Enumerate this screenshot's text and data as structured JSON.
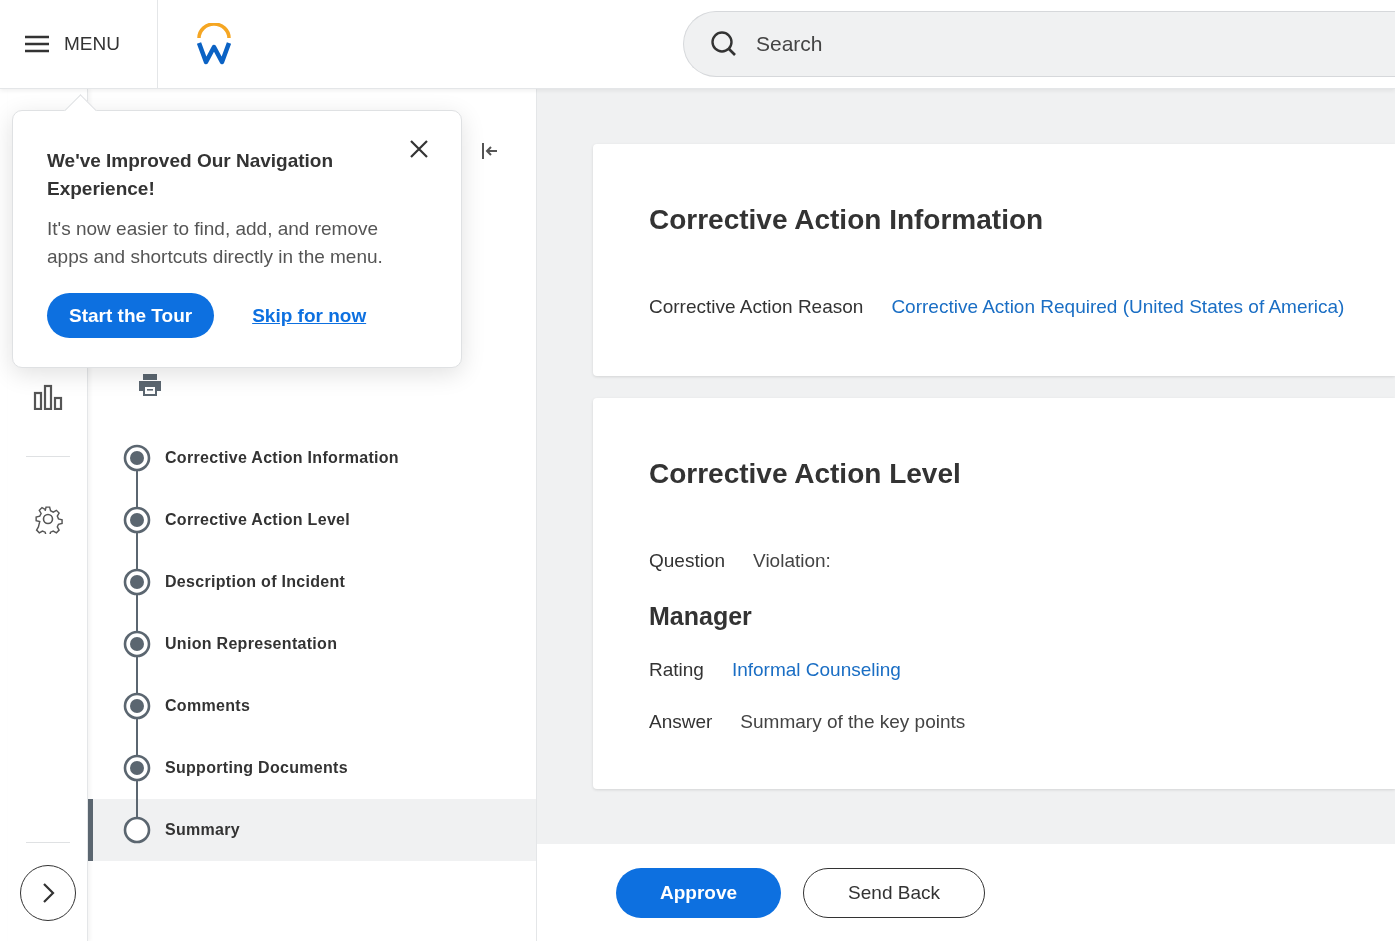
{
  "header": {
    "menu_label": "MENU",
    "search": {
      "placeholder": "Search"
    }
  },
  "popover": {
    "title": "We've Improved Our Navigation Experience!",
    "body": "It's now easier to find, add, and remove apps and shortcuts directly in the menu.",
    "primary_button": "Start the Tour",
    "link": "Skip for now"
  },
  "steps": [
    {
      "label": "Corrective Action Information",
      "completed": true,
      "selected": false
    },
    {
      "label": "Corrective Action Level",
      "completed": true,
      "selected": false
    },
    {
      "label": "Description of Incident",
      "completed": true,
      "selected": false
    },
    {
      "label": "Union Representation",
      "completed": true,
      "selected": false
    },
    {
      "label": "Comments",
      "completed": true,
      "selected": false
    },
    {
      "label": "Supporting Documents",
      "completed": true,
      "selected": false
    },
    {
      "label": "Summary",
      "completed": false,
      "selected": true
    }
  ],
  "cards": [
    {
      "title": "Corrective Action Information",
      "items": [
        {
          "kind": "field",
          "label": "Corrective Action Reason",
          "value": "Corrective Action Required (United States of America)",
          "link": true
        }
      ]
    },
    {
      "title": "Corrective Action Level",
      "items": [
        {
          "kind": "field",
          "label": "Question",
          "value": "Violation:",
          "link": false
        },
        {
          "kind": "heading",
          "text": "Manager"
        },
        {
          "kind": "field",
          "label": "Rating",
          "value": "Informal Counseling",
          "link": true
        },
        {
          "kind": "field",
          "label": "Answer",
          "value": "Summary of the key points",
          "link": false
        }
      ]
    }
  ],
  "actions": [
    {
      "label": "Approve",
      "kind": "primary"
    },
    {
      "label": "Send Back",
      "kind": "secondary"
    }
  ]
}
